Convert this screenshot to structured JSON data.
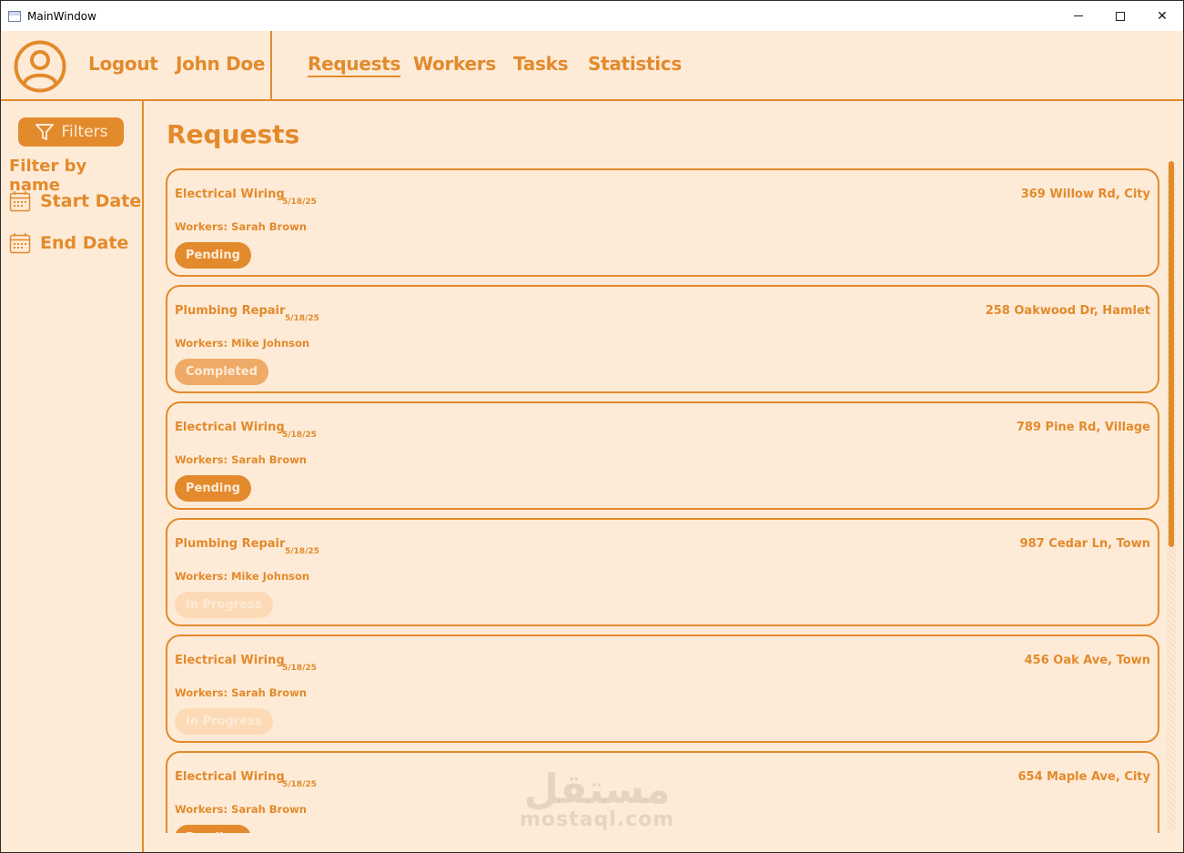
{
  "window": {
    "title": "MainWindow"
  },
  "nav": {
    "logout": "Logout",
    "user_name": "John Doe",
    "tabs": [
      "Requests",
      "Workers",
      "Tasks",
      "Statistics"
    ]
  },
  "sidebar": {
    "filters_label": "Filters",
    "filter_by_name": "Filter by name",
    "start_date": "Start Date",
    "end_date": "End Date"
  },
  "main": {
    "title": "Requests",
    "requests": [
      {
        "title": "Electrical Wiring",
        "date": "5/18/25",
        "address": "369 Willow Rd, City",
        "workers": "Workers: Sarah Brown",
        "status": "Pending"
      },
      {
        "title": "Plumbing Repair",
        "date": "5/18/25",
        "address": "258 Oakwood Dr, Hamlet",
        "workers": "Workers: Mike Johnson",
        "status": "Completed"
      },
      {
        "title": "Electrical Wiring",
        "date": "5/18/25",
        "address": "789 Pine Rd, Village",
        "workers": "Workers: Sarah Brown",
        "status": "Pending"
      },
      {
        "title": "Plumbing Repair",
        "date": "5/18/25",
        "address": "987 Cedar Ln, Town",
        "workers": "Workers: Mike Johnson",
        "status": "In Progress"
      },
      {
        "title": "Electrical Wiring",
        "date": "5/18/25",
        "address": "456 Oak Ave, Town",
        "workers": "Workers: Sarah Brown",
        "status": "In Progress"
      },
      {
        "title": "Electrical Wiring",
        "date": "5/18/25",
        "address": "654 Maple Ave, City",
        "workers": "Workers: Sarah Brown",
        "status": "Pending"
      }
    ]
  },
  "watermark": {
    "arabic": "مستقل",
    "latin": "mostaql.com"
  },
  "colors": {
    "accent": "#e38a2c",
    "background": "#fdebd7",
    "completed": "#efaa67",
    "in_progress": "#fcdab6"
  }
}
